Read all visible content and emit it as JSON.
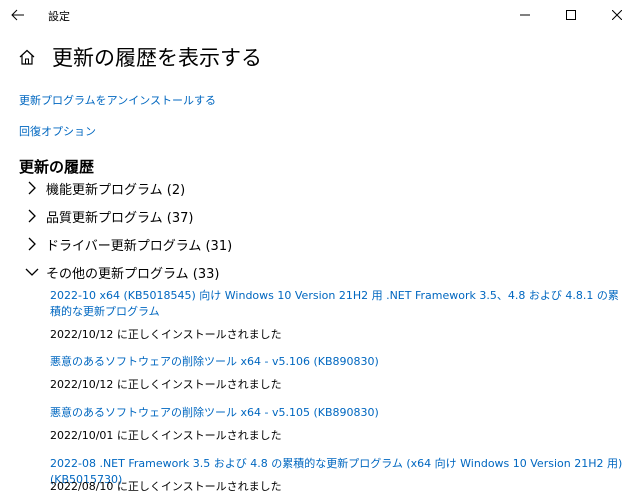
{
  "window": {
    "title": "設定",
    "back_label": "戻る",
    "minimize_label": "最小化",
    "maximize_label": "最大化",
    "close_label": "閉じる"
  },
  "page": {
    "title": "更新の履歴を表示する"
  },
  "links": {
    "uninstall": "更新プログラムをアンインストールする",
    "recovery": "回復オプション"
  },
  "history": {
    "heading": "更新の履歴",
    "categories": [
      {
        "label": "機能更新プログラム (2)",
        "expanded": false
      },
      {
        "label": "品質更新プログラム (37)",
        "expanded": false
      },
      {
        "label": "ドライバー更新プログラム (31)",
        "expanded": false
      },
      {
        "label": "その他の更新プログラム (33)",
        "expanded": true
      }
    ],
    "other_updates": [
      {
        "name": "2022-10 x64 (KB5018545) 向け Windows 10 Version 21H2 用 .NET Framework 3.5、4.8 および 4.8.1 の累積的な更新プログラム",
        "status": "2022/10/12 に正しくインストールされました"
      },
      {
        "name": "悪意のあるソフトウェアの削除ツール x64 - v5.106 (KB890830)",
        "status": "2022/10/12 に正しくインストールされました"
      },
      {
        "name": "悪意のあるソフトウェアの削除ツール x64 - v5.105 (KB890830)",
        "status": "2022/10/01 に正しくインストールされました"
      },
      {
        "name": "2022-08 .NET Framework 3.5 および 4.8 の累積的な更新プログラム (x64 向け Windows 10 Version 21H2 用) (KB5015730)",
        "status": "2022/08/10 に正しくインストールされました"
      }
    ]
  },
  "colors": {
    "link": "#0067c0",
    "text": "#000000",
    "background": "#ffffff"
  }
}
